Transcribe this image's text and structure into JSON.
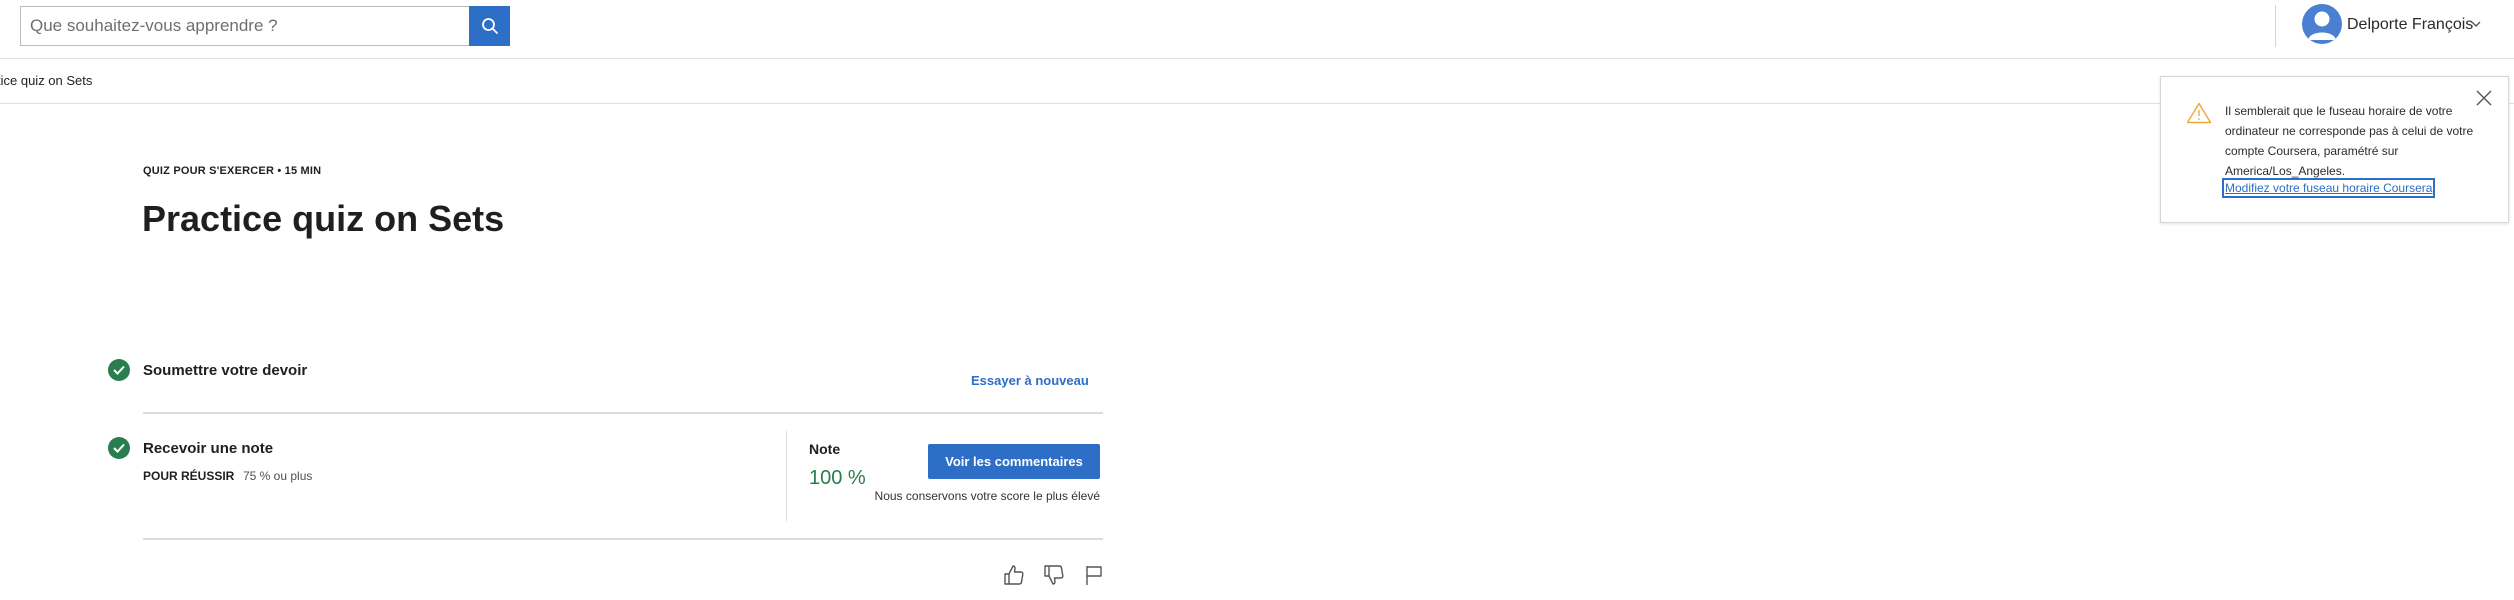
{
  "header": {
    "search_placeholder": "Que souhaitez-vous apprendre ?",
    "user_name": "Delporte François"
  },
  "breadcrumb": {
    "current": "tice quiz on Sets"
  },
  "main": {
    "kind": "QUIZ POUR S'EXERCER • 15  MIN",
    "title": "Practice quiz on Sets",
    "submit": {
      "title": "Soumettre votre devoir",
      "retry_label": "Essayer à nouveau"
    },
    "grade": {
      "title": "Recevoir une note",
      "pass_label": "POUR RÉUSSIR",
      "pass_value": "75 % ou plus",
      "note_label": "Note",
      "note_value": "100 %",
      "feedback_button": "Voir les commentaires",
      "score_note": "Nous conservons votre score le plus élevé"
    }
  },
  "toast": {
    "message": "Il semblerait que le fuseau horaire de votre ordinateur ne corresponde pas à celui de votre compte Coursera, paramétré sur America/Los_Angeles.",
    "link": "Modifiez votre fuseau horaire Coursera"
  },
  "colors": {
    "accent": "#2d6ec6",
    "success": "#2a7d4f",
    "warning": "#f0a73a"
  },
  "icons": [
    "search-icon",
    "avatar-icon",
    "chevron-down-icon",
    "check-icon",
    "thumbs-up-icon",
    "thumbs-down-icon",
    "flag-icon",
    "warning-icon",
    "close-icon"
  ]
}
